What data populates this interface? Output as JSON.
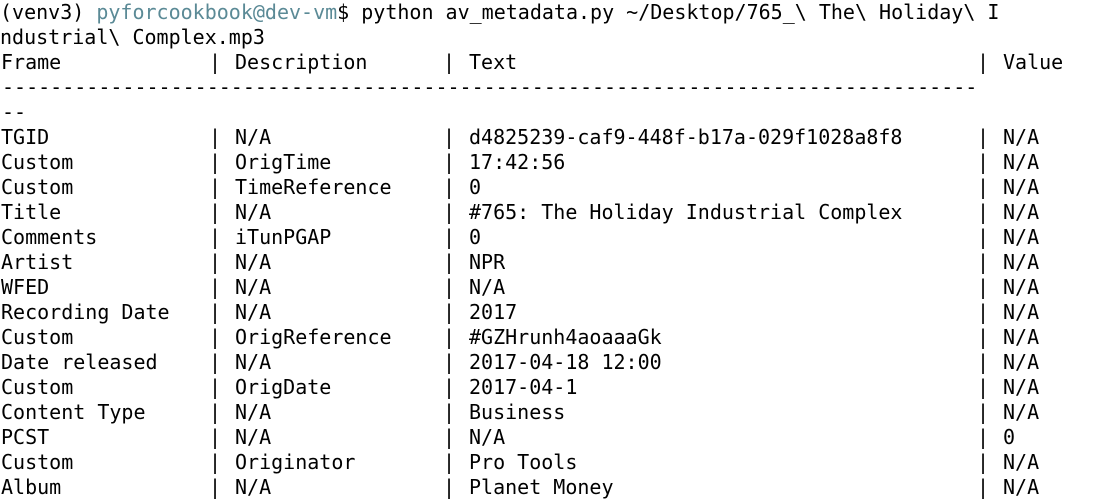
{
  "prompt": {
    "venv": "(venv3)",
    "user_host": "pyforcookbook@dev-vm",
    "symbol": "$",
    "command_line1": "python av_metadata.py ~/Desktop/765_\\ The\\ Holiday\\ I",
    "command_line2": "ndustrial\\ Complex.mp3"
  },
  "table": {
    "headers": {
      "frame": "Frame",
      "description": "Description",
      "text": "Text",
      "value": "Value"
    },
    "separator_char": "|",
    "rule_line1": "---------------------------------------------------------------------------------",
    "rule_line2": "--",
    "rows": [
      {
        "frame": "TGID",
        "description": "N/A",
        "text": "d4825239-caf9-448f-b17a-029f1028a8f8",
        "value": "N/A"
      },
      {
        "frame": "Custom",
        "description": "OrigTime",
        "text": "17:42:56",
        "value": "N/A"
      },
      {
        "frame": "Custom",
        "description": "TimeReference",
        "text": "0",
        "value": "N/A"
      },
      {
        "frame": "Title",
        "description": "N/A",
        "text": "#765: The Holiday Industrial Complex",
        "value": "N/A"
      },
      {
        "frame": "Comments",
        "description": "iTunPGAP",
        "text": "0",
        "value": "N/A"
      },
      {
        "frame": "Artist",
        "description": "N/A",
        "text": "NPR",
        "value": "N/A"
      },
      {
        "frame": "WFED",
        "description": "N/A",
        "text": "N/A",
        "value": "N/A"
      },
      {
        "frame": "Recording Date",
        "description": "N/A",
        "text": "2017",
        "value": "N/A"
      },
      {
        "frame": "Custom",
        "description": "OrigReference",
        "text": "#GZHrunh4aoaaaGk",
        "value": "N/A"
      },
      {
        "frame": "Date released",
        "description": "N/A",
        "text": "2017-04-18 12:00",
        "value": "N/A"
      },
      {
        "frame": "Custom",
        "description": "OrigDate",
        "text": "2017-04-1",
        "value": "N/A"
      },
      {
        "frame": "Content Type",
        "description": "N/A",
        "text": "Business",
        "value": "N/A"
      },
      {
        "frame": "PCST",
        "description": "N/A",
        "text": "N/A",
        "value": "0"
      },
      {
        "frame": "Custom",
        "description": "Originator",
        "text": "Pro Tools",
        "value": "N/A"
      },
      {
        "frame": "Album",
        "description": "N/A",
        "text": "Planet Money",
        "value": "N/A"
      }
    ]
  },
  "colors": {
    "background": "#ffffff",
    "text": "#000000",
    "prompt_user": "#5b8a96"
  }
}
